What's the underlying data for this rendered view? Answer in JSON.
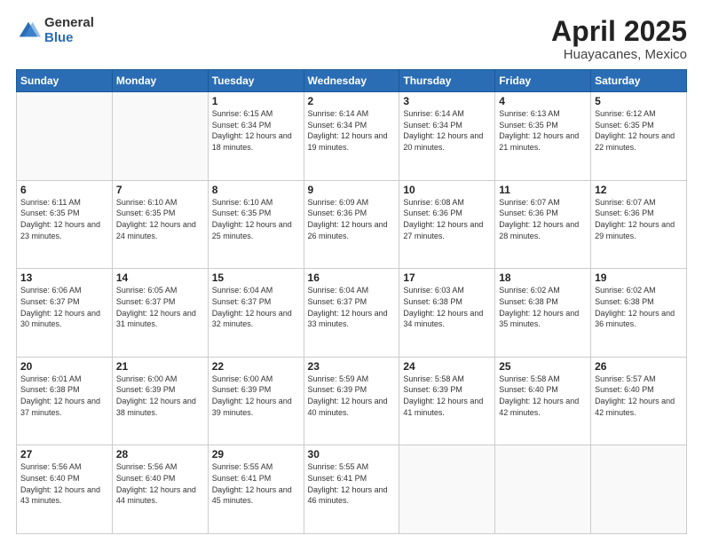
{
  "logo": {
    "general": "General",
    "blue": "Blue"
  },
  "title": "April 2025",
  "subtitle": "Huayacanes, Mexico",
  "weekdays": [
    "Sunday",
    "Monday",
    "Tuesday",
    "Wednesday",
    "Thursday",
    "Friday",
    "Saturday"
  ],
  "weeks": [
    [
      {
        "day": "",
        "sunrise": "",
        "sunset": "",
        "daylight": ""
      },
      {
        "day": "",
        "sunrise": "",
        "sunset": "",
        "daylight": ""
      },
      {
        "day": "1",
        "sunrise": "Sunrise: 6:15 AM",
        "sunset": "Sunset: 6:34 PM",
        "daylight": "Daylight: 12 hours and 18 minutes."
      },
      {
        "day": "2",
        "sunrise": "Sunrise: 6:14 AM",
        "sunset": "Sunset: 6:34 PM",
        "daylight": "Daylight: 12 hours and 19 minutes."
      },
      {
        "day": "3",
        "sunrise": "Sunrise: 6:14 AM",
        "sunset": "Sunset: 6:34 PM",
        "daylight": "Daylight: 12 hours and 20 minutes."
      },
      {
        "day": "4",
        "sunrise": "Sunrise: 6:13 AM",
        "sunset": "Sunset: 6:35 PM",
        "daylight": "Daylight: 12 hours and 21 minutes."
      },
      {
        "day": "5",
        "sunrise": "Sunrise: 6:12 AM",
        "sunset": "Sunset: 6:35 PM",
        "daylight": "Daylight: 12 hours and 22 minutes."
      }
    ],
    [
      {
        "day": "6",
        "sunrise": "Sunrise: 6:11 AM",
        "sunset": "Sunset: 6:35 PM",
        "daylight": "Daylight: 12 hours and 23 minutes."
      },
      {
        "day": "7",
        "sunrise": "Sunrise: 6:10 AM",
        "sunset": "Sunset: 6:35 PM",
        "daylight": "Daylight: 12 hours and 24 minutes."
      },
      {
        "day": "8",
        "sunrise": "Sunrise: 6:10 AM",
        "sunset": "Sunset: 6:35 PM",
        "daylight": "Daylight: 12 hours and 25 minutes."
      },
      {
        "day": "9",
        "sunrise": "Sunrise: 6:09 AM",
        "sunset": "Sunset: 6:36 PM",
        "daylight": "Daylight: 12 hours and 26 minutes."
      },
      {
        "day": "10",
        "sunrise": "Sunrise: 6:08 AM",
        "sunset": "Sunset: 6:36 PM",
        "daylight": "Daylight: 12 hours and 27 minutes."
      },
      {
        "day": "11",
        "sunrise": "Sunrise: 6:07 AM",
        "sunset": "Sunset: 6:36 PM",
        "daylight": "Daylight: 12 hours and 28 minutes."
      },
      {
        "day": "12",
        "sunrise": "Sunrise: 6:07 AM",
        "sunset": "Sunset: 6:36 PM",
        "daylight": "Daylight: 12 hours and 29 minutes."
      }
    ],
    [
      {
        "day": "13",
        "sunrise": "Sunrise: 6:06 AM",
        "sunset": "Sunset: 6:37 PM",
        "daylight": "Daylight: 12 hours and 30 minutes."
      },
      {
        "day": "14",
        "sunrise": "Sunrise: 6:05 AM",
        "sunset": "Sunset: 6:37 PM",
        "daylight": "Daylight: 12 hours and 31 minutes."
      },
      {
        "day": "15",
        "sunrise": "Sunrise: 6:04 AM",
        "sunset": "Sunset: 6:37 PM",
        "daylight": "Daylight: 12 hours and 32 minutes."
      },
      {
        "day": "16",
        "sunrise": "Sunrise: 6:04 AM",
        "sunset": "Sunset: 6:37 PM",
        "daylight": "Daylight: 12 hours and 33 minutes."
      },
      {
        "day": "17",
        "sunrise": "Sunrise: 6:03 AM",
        "sunset": "Sunset: 6:38 PM",
        "daylight": "Daylight: 12 hours and 34 minutes."
      },
      {
        "day": "18",
        "sunrise": "Sunrise: 6:02 AM",
        "sunset": "Sunset: 6:38 PM",
        "daylight": "Daylight: 12 hours and 35 minutes."
      },
      {
        "day": "19",
        "sunrise": "Sunrise: 6:02 AM",
        "sunset": "Sunset: 6:38 PM",
        "daylight": "Daylight: 12 hours and 36 minutes."
      }
    ],
    [
      {
        "day": "20",
        "sunrise": "Sunrise: 6:01 AM",
        "sunset": "Sunset: 6:38 PM",
        "daylight": "Daylight: 12 hours and 37 minutes."
      },
      {
        "day": "21",
        "sunrise": "Sunrise: 6:00 AM",
        "sunset": "Sunset: 6:39 PM",
        "daylight": "Daylight: 12 hours and 38 minutes."
      },
      {
        "day": "22",
        "sunrise": "Sunrise: 6:00 AM",
        "sunset": "Sunset: 6:39 PM",
        "daylight": "Daylight: 12 hours and 39 minutes."
      },
      {
        "day": "23",
        "sunrise": "Sunrise: 5:59 AM",
        "sunset": "Sunset: 6:39 PM",
        "daylight": "Daylight: 12 hours and 40 minutes."
      },
      {
        "day": "24",
        "sunrise": "Sunrise: 5:58 AM",
        "sunset": "Sunset: 6:39 PM",
        "daylight": "Daylight: 12 hours and 41 minutes."
      },
      {
        "day": "25",
        "sunrise": "Sunrise: 5:58 AM",
        "sunset": "Sunset: 6:40 PM",
        "daylight": "Daylight: 12 hours and 42 minutes."
      },
      {
        "day": "26",
        "sunrise": "Sunrise: 5:57 AM",
        "sunset": "Sunset: 6:40 PM",
        "daylight": "Daylight: 12 hours and 42 minutes."
      }
    ],
    [
      {
        "day": "27",
        "sunrise": "Sunrise: 5:56 AM",
        "sunset": "Sunset: 6:40 PM",
        "daylight": "Daylight: 12 hours and 43 minutes."
      },
      {
        "day": "28",
        "sunrise": "Sunrise: 5:56 AM",
        "sunset": "Sunset: 6:40 PM",
        "daylight": "Daylight: 12 hours and 44 minutes."
      },
      {
        "day": "29",
        "sunrise": "Sunrise: 5:55 AM",
        "sunset": "Sunset: 6:41 PM",
        "daylight": "Daylight: 12 hours and 45 minutes."
      },
      {
        "day": "30",
        "sunrise": "Sunrise: 5:55 AM",
        "sunset": "Sunset: 6:41 PM",
        "daylight": "Daylight: 12 hours and 46 minutes."
      },
      {
        "day": "",
        "sunrise": "",
        "sunset": "",
        "daylight": ""
      },
      {
        "day": "",
        "sunrise": "",
        "sunset": "",
        "daylight": ""
      },
      {
        "day": "",
        "sunrise": "",
        "sunset": "",
        "daylight": ""
      }
    ]
  ]
}
